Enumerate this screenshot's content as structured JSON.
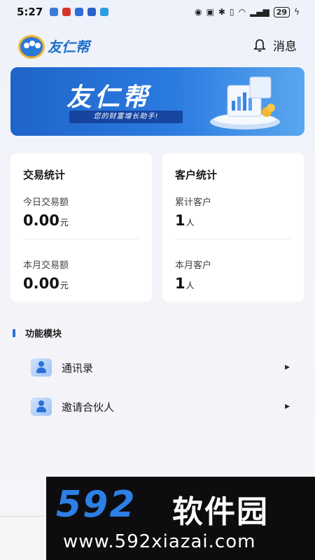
{
  "status_bar": {
    "time": "5:27",
    "battery": "29",
    "app_icon_colors": [
      "#3a7bd5",
      "#d9342b",
      "#2f6fd6",
      "#2a63c9",
      "#29a0e0"
    ]
  },
  "header": {
    "logo_text": "友仁帮",
    "message_label": "消息"
  },
  "banner": {
    "title": "友仁帮",
    "subtitle": "您的财富增长助手!"
  },
  "transaction_card": {
    "title": "交易统计",
    "today_label": "今日交易额",
    "today_value": "0.00",
    "today_unit": "元",
    "month_label": "本月交易额",
    "month_value": "0.00",
    "month_unit": "元"
  },
  "customer_card": {
    "title": "客户统计",
    "total_label": "累计客户",
    "total_value": "1",
    "total_unit": "人",
    "month_label": "本月客户",
    "month_value": "1",
    "month_unit": "人"
  },
  "functions": {
    "section_title": "功能模块",
    "items": [
      {
        "label": "通讯录",
        "icon": "contacts-icon"
      },
      {
        "label": "邀请合伙人",
        "icon": "invite-partner-icon"
      }
    ]
  },
  "watermark": {
    "number": "592",
    "name": "软件园",
    "url": "www.592xiazai.com"
  },
  "colors": {
    "accent": "#2b6fd8",
    "banner_start": "#1f64c8",
    "banner_end": "#5aa6ef"
  }
}
